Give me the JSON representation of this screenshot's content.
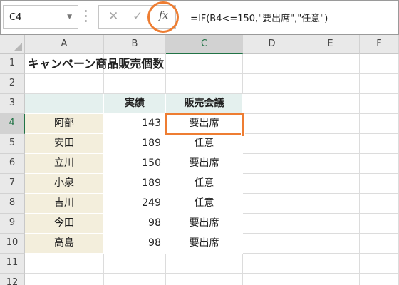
{
  "formula_bar": {
    "name_box": "C4",
    "cancel_icon": "✕",
    "enter_icon": "✓",
    "fx_label": "fx",
    "formula": "=IF(B4<=150,\"要出席\",\"任意\")"
  },
  "columns": [
    "A",
    "B",
    "C",
    "D",
    "E",
    "F"
  ],
  "rows": [
    "1",
    "2",
    "3",
    "4",
    "5",
    "6",
    "7",
    "8",
    "9",
    "10",
    "11",
    "12"
  ],
  "active_cell": "C4",
  "sheet": {
    "title": "キャンペーン商品販売個数",
    "headers": [
      "",
      "実績",
      "販売会議"
    ],
    "records": [
      {
        "name": "阿部",
        "value": "143",
        "result": "要出席"
      },
      {
        "name": "安田",
        "value": "189",
        "result": "任意"
      },
      {
        "name": "立川",
        "value": "150",
        "result": "要出席"
      },
      {
        "name": "小泉",
        "value": "189",
        "result": "任意"
      },
      {
        "name": "吉川",
        "value": "249",
        "result": "任意"
      },
      {
        "name": "今田",
        "value": "98",
        "result": "要出席"
      },
      {
        "name": "高島",
        "value": "98",
        "result": "要出席"
      }
    ]
  },
  "colors": {
    "highlight": "#ee7d32",
    "header_fill": "#e4f0ee",
    "name_fill": "#f3eedc",
    "active_header_text": "#217346"
  }
}
